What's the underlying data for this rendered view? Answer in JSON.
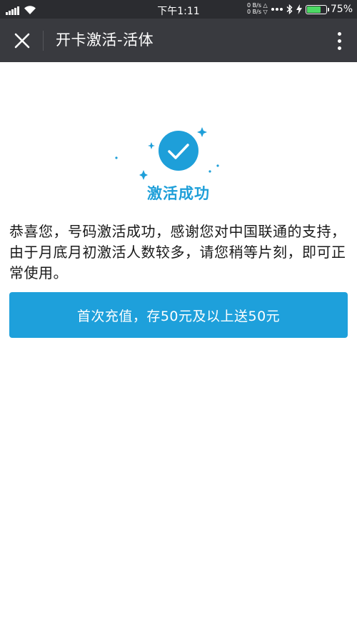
{
  "status_bar": {
    "time": "下午1:11",
    "net_up": "0 B/s △",
    "net_down": "0 B/s ▽",
    "battery_percent_text": "75%",
    "battery_level": 0.75,
    "icons": [
      "signal-icon",
      "wifi-icon",
      "more-dots-icon",
      "bluetooth-icon",
      "charging-icon",
      "battery-icon"
    ]
  },
  "title_bar": {
    "title": "开卡激活-活体",
    "close_icon": "close-icon",
    "more_icon": "more-vertical-icon"
  },
  "success": {
    "icon": "check-circle-icon",
    "title": "激活成功",
    "accent_color": "#1e9fd9"
  },
  "message": "恭喜您，号码激活成功，感谢您对中国联通的支持，由于月底月初激活人数较多，请您稍等片刻，即可正常使用。",
  "recharge_button": {
    "label": "首次充值，存50元及以上送50元",
    "color": "#1ea0db"
  }
}
